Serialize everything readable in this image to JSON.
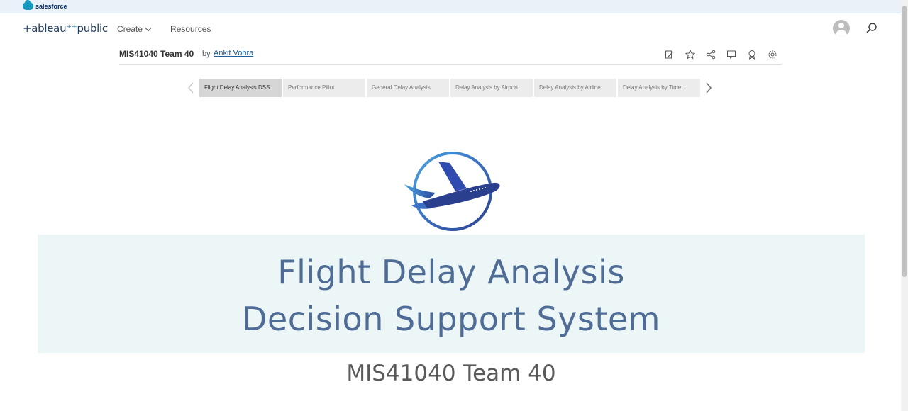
{
  "salesforce": {
    "brand": "salesforce"
  },
  "header": {
    "logo_text": "+ableau",
    "logo_suffix": "public",
    "nav": [
      {
        "label": "Create",
        "has_dropdown": true
      },
      {
        "label": "Resources",
        "has_dropdown": false
      }
    ]
  },
  "workbook": {
    "title": "MIS41040 Team 40",
    "by": "by",
    "author": "Ankit Vohra",
    "actions": [
      "edit-icon",
      "star-icon",
      "share-icon",
      "comment-icon",
      "badge-icon",
      "settings-icon"
    ]
  },
  "tabs": [
    {
      "label": "Flight Delay Analysis DSS",
      "active": true
    },
    {
      "label": "Performance Pillot",
      "active": false
    },
    {
      "label": "General Delay Analysis",
      "active": false
    },
    {
      "label": "Delay Analysis by Airport",
      "active": false
    },
    {
      "label": "Delay Analysis by Airline",
      "active": false
    },
    {
      "label": "Delay Analysis by Time..",
      "active": false
    }
  ],
  "dashboard": {
    "logo_icon": "airplane-circle-logo",
    "banner_line1": "Flight Delay Analysis",
    "banner_line2": "Decision Support System",
    "team_line": "MIS41040 Team 40"
  },
  "colors": {
    "banner_bg": "#edf6f6",
    "title_dark": "#4e6c95",
    "title_mid": "#7fa0c3",
    "title_light": "#a9c7dd",
    "logo_blue": "#2b3f8f",
    "logo_accent": "#4aa3df"
  }
}
